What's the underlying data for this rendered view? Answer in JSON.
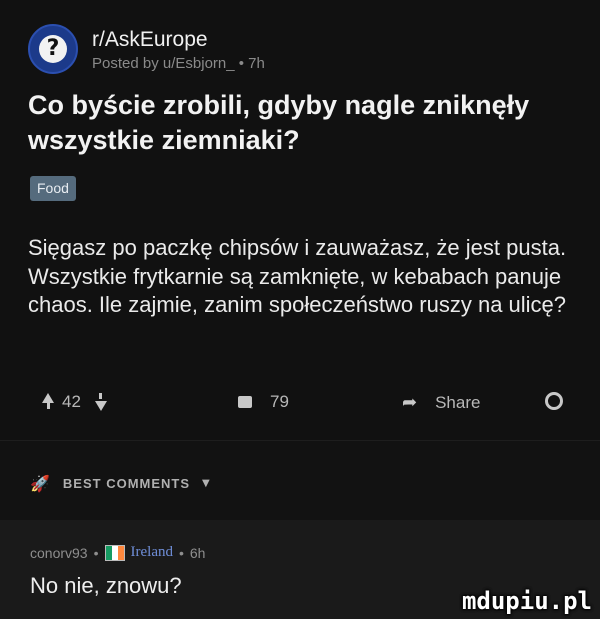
{
  "post": {
    "subreddit": "r/AskEurope",
    "meta": "Posted by u/Esbjorn_ • 7h",
    "title": "Co byście zrobili, gdyby nagle zniknęły wszystkie ziemniaki?",
    "flair": "Food",
    "body": "Sięgasz po paczkę chipsów i zauważasz, że jest pusta. Wszystkie frytkarnie są zamknięte, w kebabach panuje chaos. Ile zajmie, zanim społeczeństwo ruszy na ulicę?",
    "actions": {
      "score": "42",
      "comments": "79",
      "share_label": "Share"
    }
  },
  "best_comments": {
    "label": "BEST COMMENTS"
  },
  "comment": {
    "author": "conorv93",
    "separator": "•",
    "country": "Ireland",
    "time": "6h",
    "text": "No nie, znowu?",
    "flag_colors": [
      "#169b62",
      "#ffffff",
      "#ff883e"
    ]
  },
  "watermark": "mdupiu.pl",
  "icons": [
    "question-mark-avatar-icon",
    "upvote-icon",
    "downvote-icon",
    "comment-icon",
    "share-icon",
    "gear-icon",
    "rocket-icon",
    "chevron-down-icon"
  ]
}
